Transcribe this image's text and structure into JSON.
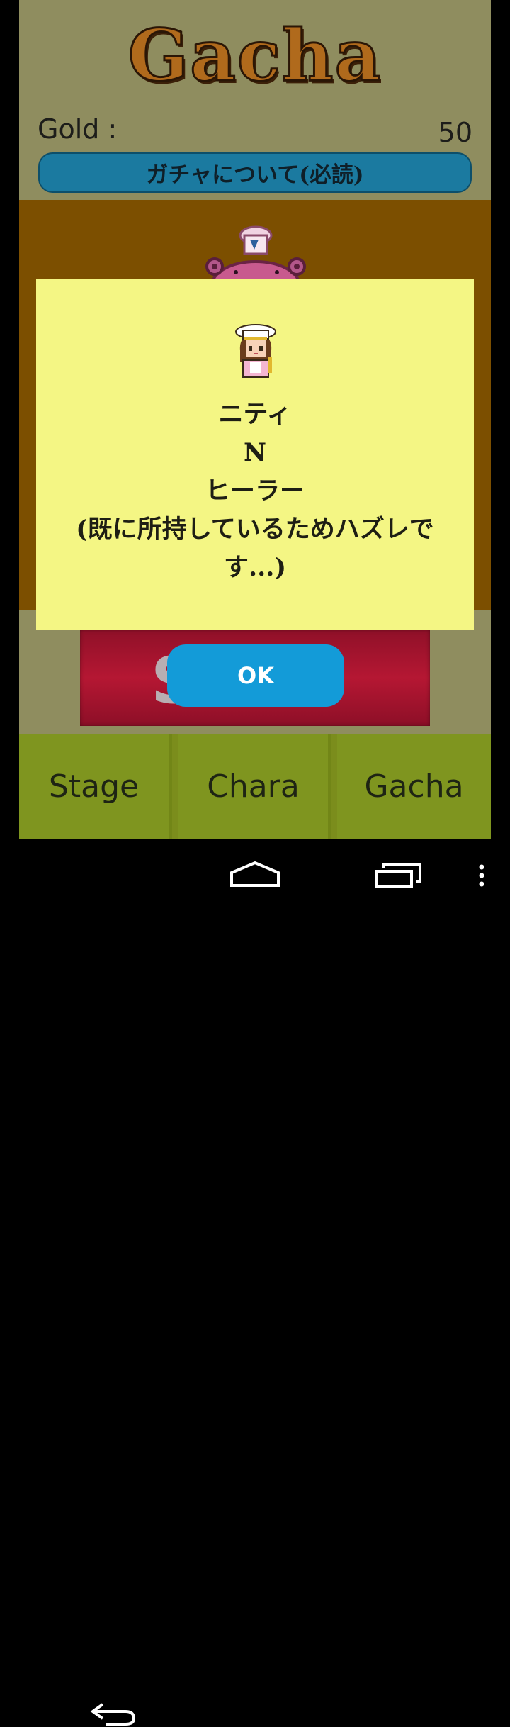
{
  "header": {
    "title": "Gacha",
    "gold_label": "Gold :",
    "gold_value": "50",
    "about_button": "ガチャについて(必読)"
  },
  "dialog": {
    "character_name": "ニティ",
    "rarity": "N",
    "role": "ヒーラー",
    "message": "(既に所持しているためハズレです...)",
    "ok_label": "OK"
  },
  "tabs": [
    {
      "label": "Stage"
    },
    {
      "label": "Chara"
    },
    {
      "label": "Gacha"
    }
  ],
  "icons": {
    "back": "back-arrow-icon",
    "home": "home-icon",
    "recents": "recents-icon",
    "menu": "overflow-menu-icon"
  },
  "colors": {
    "background": "#8f8d5f",
    "banner": "#7c4f00",
    "dialog": "#f4f684",
    "ok_button": "#139bd8",
    "tab_bar": "#7f951f",
    "about_button": "#1b7aa0"
  }
}
